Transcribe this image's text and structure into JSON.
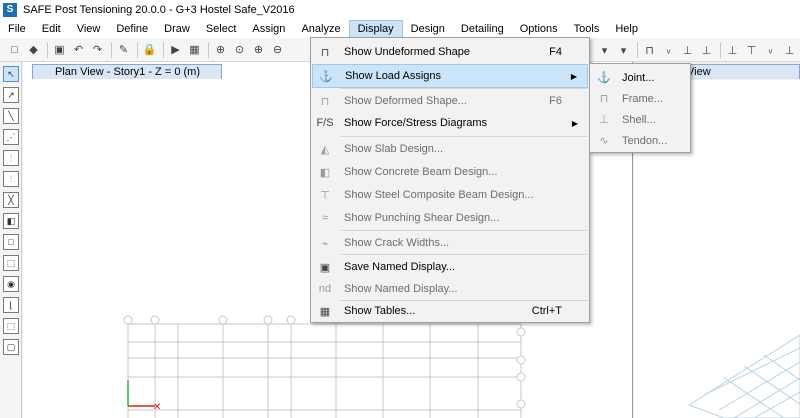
{
  "window": {
    "title": "SAFE Post Tensioning 20.0.0 - G+3 Hostel Safe_V2016",
    "app_icon": "S"
  },
  "menubar": [
    "File",
    "Edit",
    "View",
    "Define",
    "Draw",
    "Select",
    "Assign",
    "Analyze",
    "Display",
    "Design",
    "Detailing",
    "Options",
    "Tools",
    "Help"
  ],
  "active_menu": "Display",
  "tabs": {
    "plan_view": "Plan View - Story1 - Z = 0 (m)",
    "right_view": "View"
  },
  "display_menu": [
    {
      "label": "Show Undeformed Shape",
      "shortcut": "F4",
      "icon": "undeformed-shape-icon",
      "enabled": true
    },
    {
      "label": "Show Load Assigns",
      "shortcut": "",
      "icon": "load-assigns-icon",
      "enabled": true,
      "submenu": true,
      "highlighted": true
    },
    {
      "label": "Show Deformed Shape...",
      "shortcut": "F6",
      "icon": "deformed-shape-icon",
      "enabled": false
    },
    {
      "label": "Show Force/Stress Diagrams",
      "shortcut": "",
      "icon": "force-stress-icon",
      "enabled": true,
      "submenu": true
    },
    {
      "label": "Show Slab Design...",
      "shortcut": "",
      "icon": "slab-design-icon",
      "enabled": false
    },
    {
      "label": "Show Concrete Beam Design...",
      "shortcut": "",
      "icon": "concrete-beam-icon",
      "enabled": false
    },
    {
      "label": "Show Steel Composite Beam Design...",
      "shortcut": "",
      "icon": "steel-beam-icon",
      "enabled": false
    },
    {
      "label": "Show Punching Shear Design...",
      "shortcut": "",
      "icon": "punching-shear-icon",
      "enabled": false
    },
    {
      "label": "Show Crack Widths...",
      "shortcut": "",
      "icon": "crack-widths-icon",
      "enabled": false
    },
    {
      "label": "Save Named Display...",
      "shortcut": "",
      "icon": "save-named-display-icon",
      "enabled": true
    },
    {
      "label": "Show Named Display...",
      "shortcut": "",
      "icon": "show-named-display-icon",
      "enabled": false
    },
    {
      "label": "Show Tables...",
      "shortcut": "Ctrl+T",
      "icon": "tables-icon",
      "enabled": true
    }
  ],
  "load_assigns_submenu": [
    {
      "label": "Joint...",
      "icon": "joint-load-icon",
      "enabled": true
    },
    {
      "label": "Frame...",
      "icon": "frame-load-icon",
      "enabled": false
    },
    {
      "label": "Shell...",
      "icon": "shell-load-icon",
      "enabled": false
    },
    {
      "label": "Tendon...",
      "icon": "tendon-load-icon",
      "enabled": false
    }
  ],
  "colors": {
    "menu_highlight": "#cce4f7",
    "menu_highlight_border": "#99c9ef",
    "axis_x": "#e02020",
    "axis_y": "#20c020",
    "grid": "#c8c8c8"
  }
}
